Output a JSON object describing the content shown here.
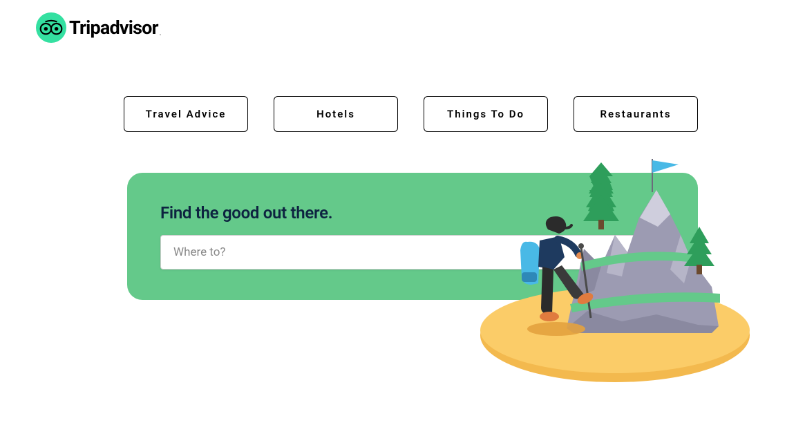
{
  "brand": {
    "name": "Tripadvisor"
  },
  "nav": {
    "tabs": [
      {
        "label": "Travel Advice"
      },
      {
        "label": "Hotels"
      },
      {
        "label": "Things To Do"
      },
      {
        "label": "Restaurants"
      }
    ]
  },
  "search": {
    "heading": "Find the good out there.",
    "placeholder": "Where to?"
  },
  "colors": {
    "brand_green": "#34E0A1",
    "card_green": "#64C98A",
    "heading_navy": "#0D2340"
  }
}
